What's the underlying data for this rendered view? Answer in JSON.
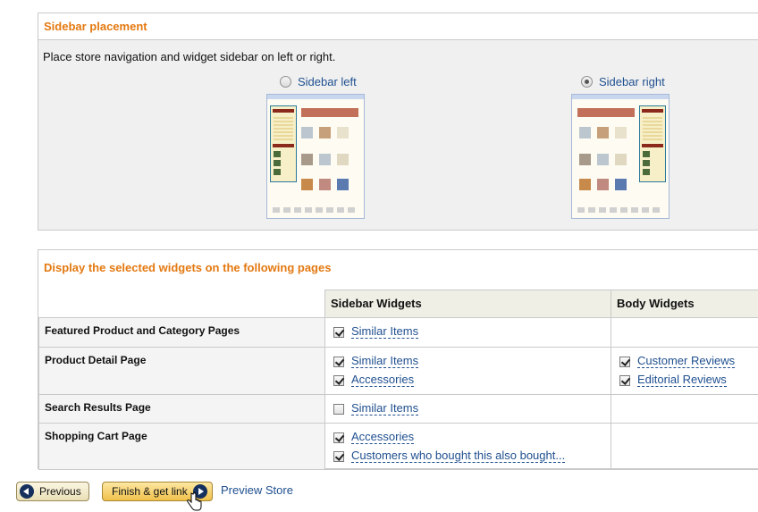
{
  "placement": {
    "title": "Sidebar placement",
    "description": "Place store navigation and widget sidebar on left or right.",
    "options": [
      {
        "label": "Sidebar left",
        "selected": false
      },
      {
        "label": "Sidebar right",
        "selected": true
      }
    ]
  },
  "widgets": {
    "title": "Display the selected widgets on the following pages",
    "columns": [
      "Sidebar Widgets",
      "Body Widgets"
    ],
    "rows": [
      {
        "page": "Featured Product and Category Pages",
        "sidebar": [
          {
            "label": "Similar Items",
            "checked": true
          }
        ],
        "body": []
      },
      {
        "page": "Product Detail Page",
        "sidebar": [
          {
            "label": "Similar Items",
            "checked": true
          },
          {
            "label": "Accessories",
            "checked": true
          }
        ],
        "body": [
          {
            "label": "Customer Reviews",
            "checked": true
          },
          {
            "label": "Editorial Reviews",
            "checked": true
          }
        ]
      },
      {
        "page": "Search Results Page",
        "sidebar": [
          {
            "label": "Similar Items",
            "checked": false
          }
        ],
        "body": []
      },
      {
        "page": "Shopping Cart Page",
        "sidebar": [
          {
            "label": "Accessories",
            "checked": true
          },
          {
            "label": "Customers who bought this also bought...",
            "checked": true
          }
        ],
        "body": []
      }
    ]
  },
  "footer": {
    "previous_label": "Previous",
    "finish_label": "Finish & get link",
    "preview_label": "Preview Store"
  },
  "colors": {
    "header_accent": "#e47911",
    "link": "#1f4f8f",
    "finish_button": "#f0c14b"
  }
}
